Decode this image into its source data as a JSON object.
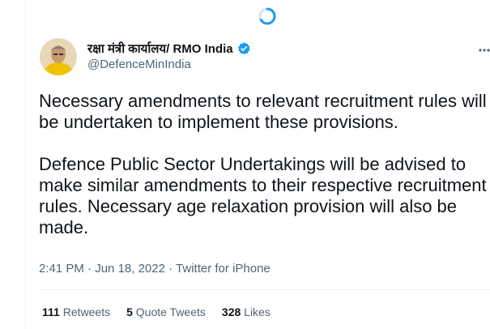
{
  "tweet": {
    "author_name": "रक्षा मंत्री कार्यालय/ RMO India",
    "handle": "@DefenceMinIndia",
    "paragraphs": [
      "Necessary amendments to relevant recruitment rules will be undertaken to implement these provisions.",
      "Defence Public Sector Undertakings will be advised to make similar amendments to their respective recruitment rules. Necessary age relaxation provision will also be made."
    ],
    "time": "2:41 PM",
    "date": "Jun 18, 2022",
    "source": "Twitter for iPhone",
    "separator": "·"
  },
  "stats": {
    "retweets_count": "111",
    "retweets_label": "Retweets",
    "quotes_count": "5",
    "quotes_label": "Quote Tweets",
    "likes_count": "328",
    "likes_label": "Likes"
  },
  "icons": {
    "loading": "loading-spinner-icon",
    "verified": "verified-badge-icon",
    "more": "more-icon"
  },
  "colors": {
    "accent": "#1d9bf0",
    "text": "#0f1419",
    "secondary": "#536471",
    "divider": "#eff3f4"
  }
}
